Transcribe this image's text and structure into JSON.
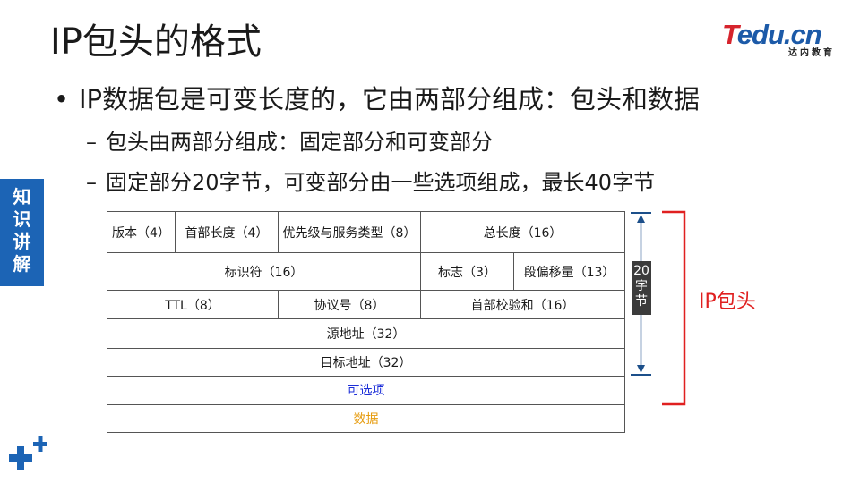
{
  "slide": {
    "title": "IP包头的格式",
    "bullet": "IP数据包是可变长度的，它由两部分组成：包头和数据",
    "subs": [
      "包头由两部分组成：固定部分和可变部分",
      "固定部分20字节，可变部分由一些选项组成，最长40字节"
    ]
  },
  "logo": {
    "brand_t": "T",
    "brand_rest": "edu.cn",
    "sub": "达内教育"
  },
  "side_tab": {
    "chars": [
      "知",
      "识",
      "讲",
      "解"
    ]
  },
  "icons": {
    "plus": "plus-cross-icon"
  },
  "colors": {
    "accent_blue": "#1c64b5",
    "logo_red": "#d6242d",
    "logo_blue": "#1c5aa8",
    "bracket_red": "#e02020",
    "options_blue": "#1d2fd8",
    "data_orange": "#e69a0a"
  },
  "header_table": {
    "row1": [
      "版本（4）",
      "首部长度（4）",
      "优先级与服务类型（8）",
      "总长度（16）"
    ],
    "row2": [
      "标识符（16）",
      "标志（3）",
      "段偏移量（13）"
    ],
    "row3": [
      "TTL（8）",
      "协议号（8）",
      "首部校验和（16）"
    ],
    "row4": "源地址（32）",
    "row5": "目标地址（32）",
    "row6": "可选项",
    "row7": "数据"
  },
  "fixed_size": {
    "chars": [
      "20",
      "字",
      "节"
    ]
  },
  "bracket_label": "IP包头"
}
